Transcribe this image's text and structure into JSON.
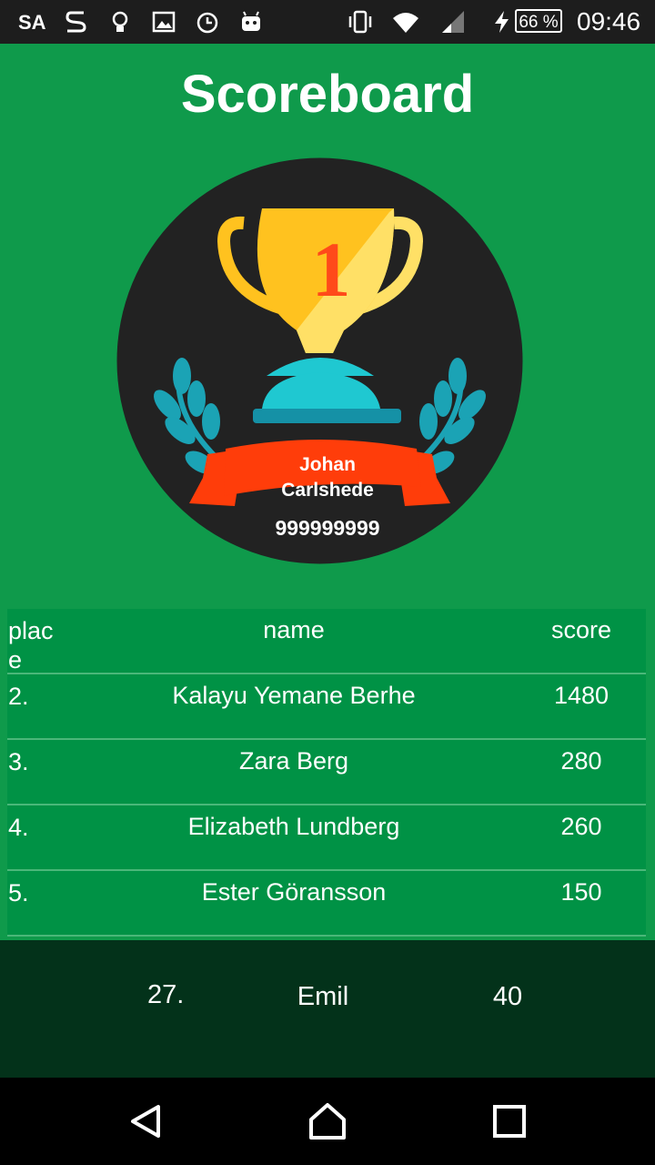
{
  "status_bar": {
    "carrier": "SA",
    "battery": "66 %",
    "time": "09:46",
    "icons": [
      "s-app-icon",
      "lightbulb-icon",
      "image-icon",
      "alarm-icon",
      "android-icon",
      "vibrate-icon",
      "wifi-icon",
      "signal-icon",
      "charging-icon"
    ]
  },
  "title": "Scoreboard",
  "winner": {
    "name_line1": "Johan",
    "name_line2": "Carlshede",
    "score": "999999999",
    "trophy_number": "1"
  },
  "table": {
    "headers": [
      "place",
      "name",
      "score"
    ],
    "rows": [
      {
        "place": "2.",
        "name": "Kalayu Yemane Berhe",
        "score": "1480"
      },
      {
        "place": "3.",
        "name": "Zara Berg",
        "score": "280"
      },
      {
        "place": "4.",
        "name": "Elizabeth Lundberg",
        "score": "260"
      },
      {
        "place": "5.",
        "name": "Ester Göransson",
        "score": "150"
      }
    ]
  },
  "current_user": {
    "place": "27.",
    "name": "Emil",
    "score": "40"
  },
  "colors": {
    "background": "#0f9a4b",
    "table_row": "#009245",
    "footer": "#03321a",
    "ribbon": "#ff3d0a",
    "trophy": "#ffc21f"
  }
}
